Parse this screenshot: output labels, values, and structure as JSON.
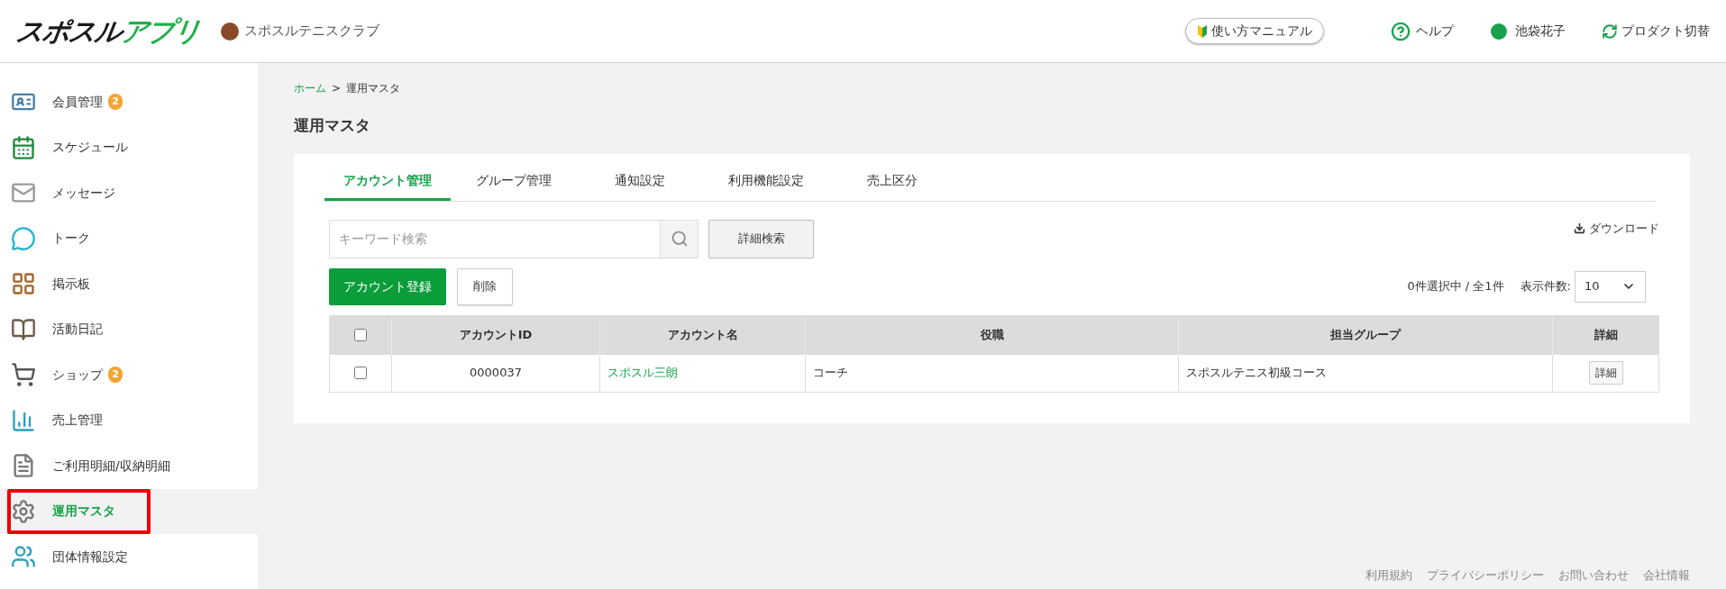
{
  "header": {
    "logo": {
      "dark": "スポスル",
      "green": "アプリ"
    },
    "club": "スポスルテニスクラブ",
    "manual": "使い方マニュアル",
    "help": "ヘルプ",
    "user": "池袋花子",
    "switch": "プロダクト切替"
  },
  "sidebar": {
    "items": [
      {
        "label": "会員管理",
        "badge": "2",
        "selected": false,
        "highlighted": false
      },
      {
        "label": "スケジュール",
        "selected": false,
        "highlighted": false
      },
      {
        "label": "メッセージ",
        "selected": false,
        "highlighted": false
      },
      {
        "label": "トーク",
        "selected": false,
        "highlighted": false
      },
      {
        "label": "掲示板",
        "selected": false,
        "highlighted": false
      },
      {
        "label": "活動日記",
        "selected": false,
        "highlighted": false
      },
      {
        "label": "ショップ",
        "badge": "2",
        "selected": false,
        "highlighted": false
      },
      {
        "label": "売上管理",
        "selected": false,
        "highlighted": false
      },
      {
        "label": "ご利用明細/収納明細",
        "selected": false,
        "highlighted": false
      },
      {
        "label": "運用マスタ",
        "selected": true,
        "highlighted": true
      },
      {
        "label": "団体情報設定",
        "selected": false,
        "highlighted": false
      }
    ]
  },
  "breadcrumb": [
    {
      "label": "ホーム",
      "link": true
    },
    {
      "label": ">",
      "link": false
    },
    {
      "label": "運用マスタ",
      "link": false
    }
  ],
  "page_title": "運用マスタ",
  "tabs": [
    {
      "label": "アカウント管理",
      "selected": true
    },
    {
      "label": "グループ管理",
      "selected": false
    },
    {
      "label": "通知設定",
      "selected": false
    },
    {
      "label": "利用機能設定",
      "selected": false
    },
    {
      "label": "売上区分",
      "selected": false
    }
  ],
  "search": {
    "placeholder": "キーワード検索",
    "advanced": "詳細検索"
  },
  "download": "ダウンロード",
  "actions": {
    "register": "アカウント登録",
    "delete": "削除"
  },
  "selection_count": "0件選択中 / 全1件",
  "page_size": {
    "label": "表示件数:",
    "value": "10"
  },
  "table": {
    "select_all_checked": false,
    "columns": [
      "アカウントID",
      "アカウント名",
      "役職",
      "担当グループ",
      "詳細"
    ],
    "rows": [
      {
        "checked": false,
        "id": "0000037",
        "name": "スポスル三朗",
        "role": "コーチ",
        "group": "スポスルテニス初級コース",
        "detail": "詳細"
      }
    ]
  },
  "footer": [
    "利用規約",
    "プライバシーポリシー",
    "お問い合わせ",
    "会社情報"
  ]
}
